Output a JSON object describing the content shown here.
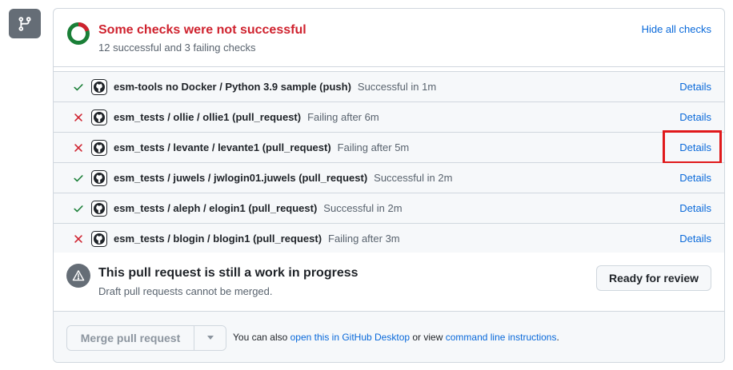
{
  "header": {
    "title": "Some checks were not successful",
    "subtitle": "12 successful and 3 failing checks",
    "hide_label": "Hide all checks",
    "donut_colors": {
      "success": "#1a7f37",
      "failure": "#cf222e"
    }
  },
  "checks": [
    {
      "status": "success",
      "name": "esm-tools no Docker / Python 3.9 sample (push)",
      "result": "Successful in 1m",
      "details": "Details",
      "highlighted": false
    },
    {
      "status": "failure",
      "name": "esm_tests / ollie / ollie1 (pull_request)",
      "result": "Failing after 6m",
      "details": "Details",
      "highlighted": false
    },
    {
      "status": "failure",
      "name": "esm_tests / levante / levante1 (pull_request)",
      "result": "Failing after 5m",
      "details": "Details",
      "highlighted": true
    },
    {
      "status": "success",
      "name": "esm_tests / juwels / jwlogin01.juwels (pull_request)",
      "result": "Successful in 2m",
      "details": "Details",
      "highlighted": false
    },
    {
      "status": "success",
      "name": "esm_tests / aleph / elogin1 (pull_request)",
      "result": "Successful in 2m",
      "details": "Details",
      "highlighted": false
    },
    {
      "status": "failure",
      "name": "esm_tests / blogin / blogin1 (pull_request)",
      "result": "Failing after 3m",
      "details": "Details",
      "highlighted": false
    }
  ],
  "wip": {
    "title": "This pull request is still a work in progress",
    "subtitle": "Draft pull requests cannot be merged.",
    "ready_label": "Ready for review"
  },
  "merge": {
    "button_label": "Merge pull request",
    "note_prefix": "You can also ",
    "desktop_link": "open this in GitHub Desktop",
    "note_middle": " or view ",
    "cli_link": "command line instructions",
    "note_suffix": "."
  },
  "icons": {
    "branch": "git-branch-icon",
    "success": "check-icon",
    "failure": "x-icon",
    "app": "github-icon",
    "warning": "alert-icon",
    "caret": "triangle-down-icon"
  },
  "colors": {
    "accent": "#0969da",
    "success": "#1a7f37",
    "failure": "#cf222e",
    "highlight": "#e0191b"
  }
}
